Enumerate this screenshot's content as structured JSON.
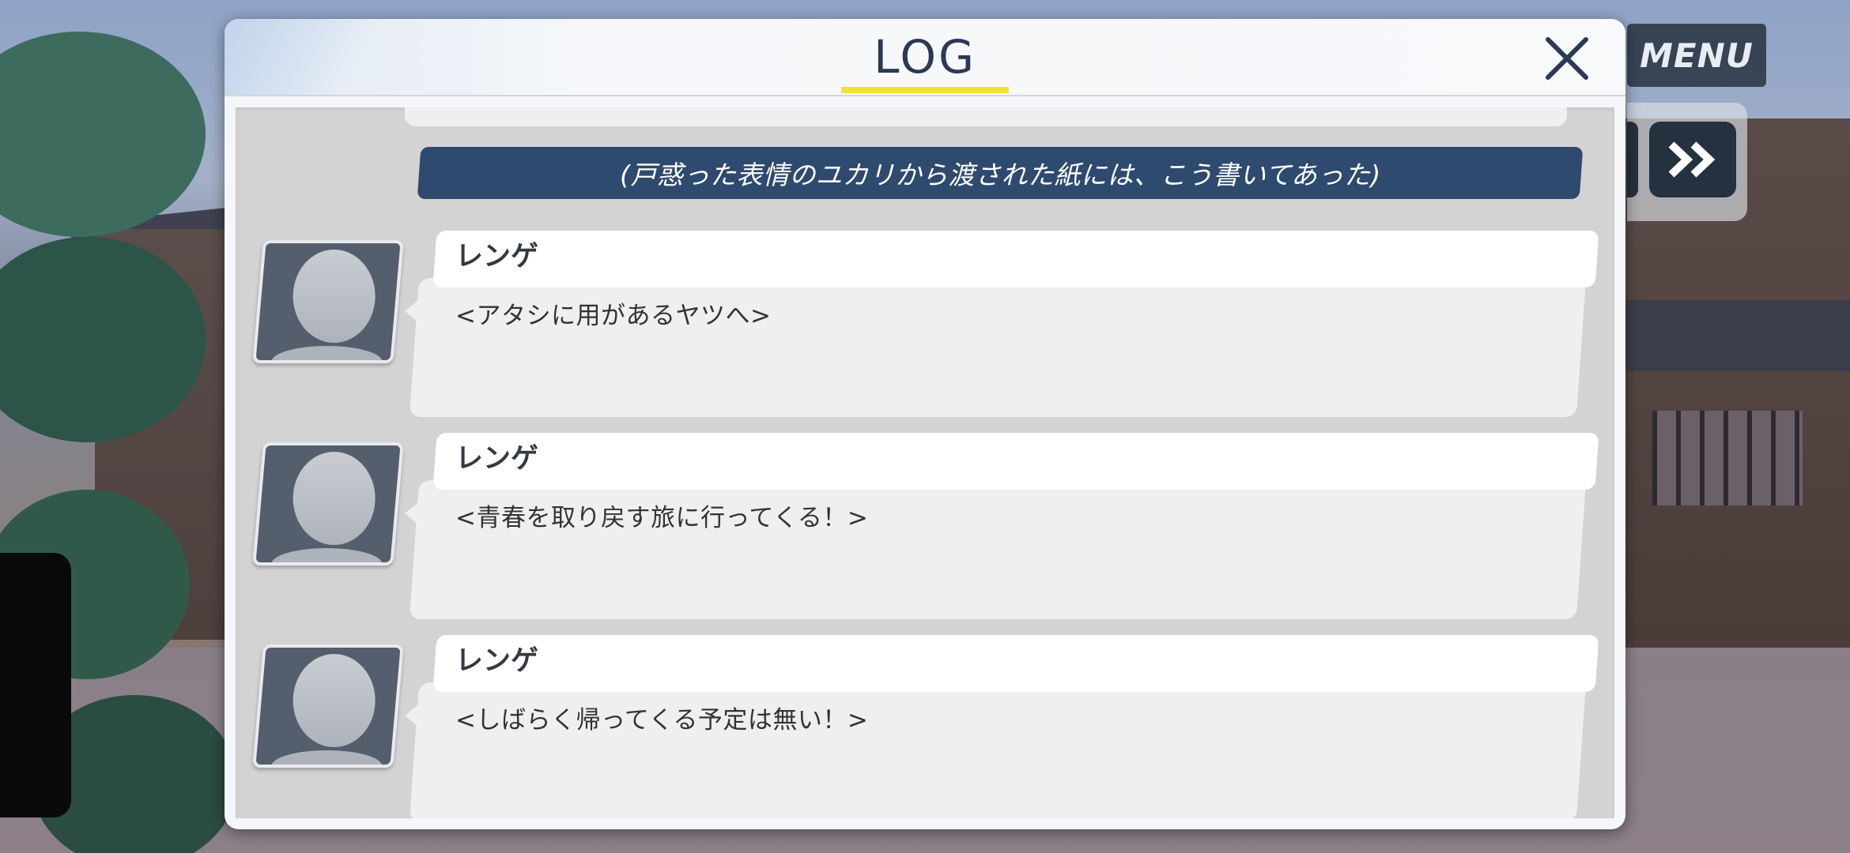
{
  "hud": {
    "menu_label": "MENU",
    "skip_icon": "double-chevron-right-icon"
  },
  "log": {
    "title": "LOG",
    "close_icon": "close-icon",
    "narration": "(戸惑った表情のユカリから渡された紙には、こう書いてあった)",
    "entries": [
      {
        "speaker": "レンゲ",
        "text": "<アタシに用があるヤツへ>"
      },
      {
        "speaker": "レンゲ",
        "text": "<青春を取り戻す旅に行ってくる！>"
      },
      {
        "speaker": "レンゲ",
        "text": "<しばらく帰ってくる予定は無い！>"
      }
    ]
  },
  "colors": {
    "accent_underline": "#f2e332",
    "narration_bg": "#2e4a6e",
    "title_text": "#2a3a55"
  }
}
